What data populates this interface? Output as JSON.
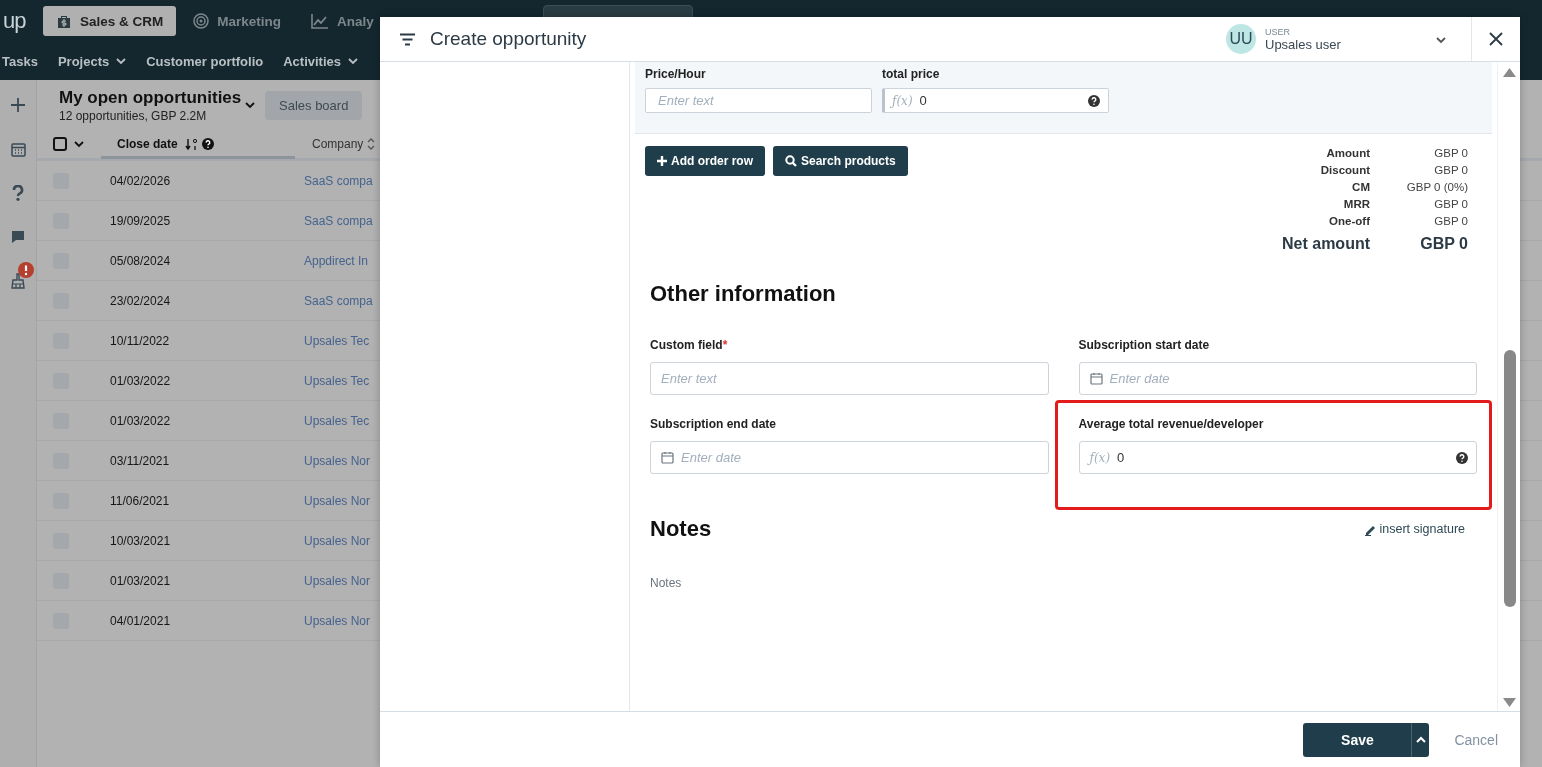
{
  "top_nav": {
    "logo": "up",
    "tabs": [
      {
        "label": "Sales & CRM",
        "selected": true
      },
      {
        "label": "Marketing",
        "selected": false
      },
      {
        "label": "Analy",
        "selected": false
      }
    ]
  },
  "sub_nav": {
    "items": [
      {
        "label": "Tasks",
        "dropdown": false
      },
      {
        "label": "Projects",
        "dropdown": true
      },
      {
        "label": "Customer portfolio",
        "dropdown": false
      },
      {
        "label": "Activities",
        "dropdown": true
      }
    ]
  },
  "side_rail": {
    "items": [
      {
        "kind": "plus",
        "badge": false
      },
      {
        "kind": "calendar",
        "badge": false
      },
      {
        "kind": "help",
        "badge": false
      },
      {
        "kind": "chat",
        "badge": false
      },
      {
        "kind": "broom",
        "badge": true
      }
    ]
  },
  "list": {
    "title": "My open opportunities",
    "subtitle": "12 opportunities, GBP 2.2M",
    "view_button": "Sales board",
    "select_all": {
      "checked": false
    },
    "columns": [
      {
        "label": "Close date",
        "sorted": true
      },
      {
        "label": "Company",
        "sorted": false
      }
    ],
    "rows": [
      {
        "close_date": "04/02/2026",
        "company": "SaaS compa",
        "checked": false
      },
      {
        "close_date": "19/09/2025",
        "company": "SaaS compa",
        "checked": false
      },
      {
        "close_date": "05/08/2024",
        "company": "Appdirect In",
        "checked": false
      },
      {
        "close_date": "23/02/2024",
        "company": "SaaS compa",
        "checked": false
      },
      {
        "close_date": "10/11/2022",
        "company": "Upsales Tec",
        "checked": false
      },
      {
        "close_date": "01/03/2022",
        "company": "Upsales Tec",
        "checked": false
      },
      {
        "close_date": "01/03/2022",
        "company": "Upsales Tec",
        "checked": false
      },
      {
        "close_date": "03/11/2021",
        "company": "Upsales Nor",
        "checked": false
      },
      {
        "close_date": "11/06/2021",
        "company": "Upsales Nor",
        "checked": false
      },
      {
        "close_date": "10/03/2021",
        "company": "Upsales Nor",
        "checked": false
      },
      {
        "close_date": "01/03/2021",
        "company": "Upsales Nor",
        "checked": false
      },
      {
        "close_date": "04/01/2021",
        "company": "Upsales Nor",
        "checked": false
      }
    ]
  },
  "modal": {
    "title": "Create opportunity",
    "user": {
      "initials": "UU",
      "role": "USER",
      "name": "Upsales user"
    },
    "order_row": {
      "fields": [
        {
          "kind": "text",
          "label": "Price/Hour",
          "placeholder": "Enter text"
        },
        {
          "kind": "formula",
          "label": "total price",
          "formula_sign": "ƒ(x)",
          "value": "0"
        }
      ]
    },
    "buttons": [
      {
        "kind": "add",
        "label": "Add order row"
      },
      {
        "kind": "search",
        "label": "Search products"
      }
    ],
    "summary": [
      {
        "label": "Amount",
        "value": "GBP 0"
      },
      {
        "label": "Discount",
        "value": "GBP 0"
      },
      {
        "label": "CM",
        "value": "GBP 0 (0%)"
      },
      {
        "label": "MRR",
        "value": "GBP 0"
      },
      {
        "label": "One-off",
        "value": "GBP 0"
      }
    ],
    "net": {
      "label": "Net amount",
      "value": "GBP 0"
    },
    "other_information": {
      "heading": "Other information",
      "fields": [
        {
          "kind": "text",
          "label": "Custom field",
          "required_mark": "*",
          "placeholder": "Enter text",
          "highlighted": false
        },
        {
          "kind": "date",
          "label": "Subscription start date",
          "placeholder": "Enter date",
          "highlighted": false
        },
        {
          "kind": "date",
          "label": "Subscription end date",
          "placeholder": "Enter date",
          "highlighted": false
        },
        {
          "kind": "formula",
          "label": "Average total revenue/developer",
          "formula_sign": "ƒ(x)",
          "value": "0",
          "highlighted": true
        }
      ]
    },
    "notes": {
      "heading": "Notes",
      "signature_link": "insert signature",
      "placeholder": "Notes"
    },
    "footer": {
      "save": "Save",
      "cancel": "Cancel"
    }
  }
}
